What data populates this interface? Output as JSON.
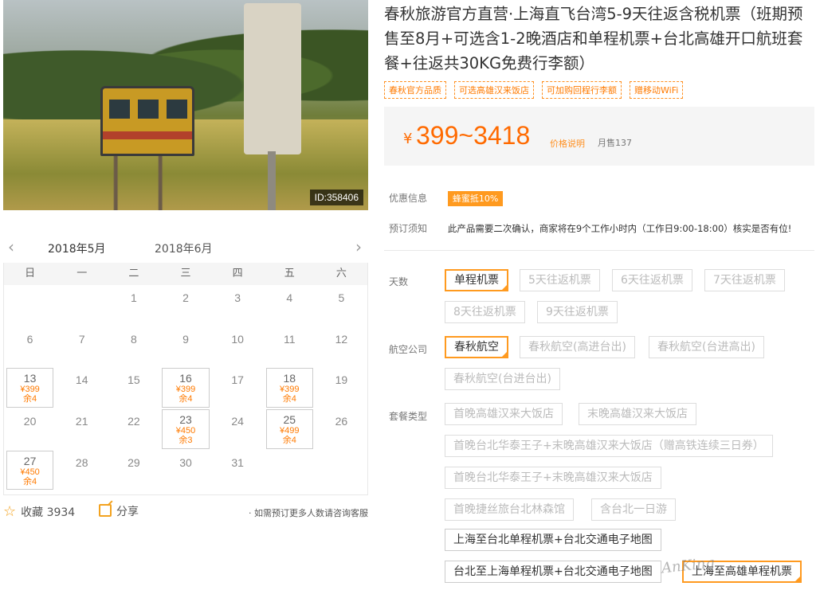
{
  "photo": {
    "id_label": "ID:358406"
  },
  "calendar": {
    "prev_icon": "chevron-left-icon",
    "next_icon": "chevron-right-icon",
    "months": [
      "2018年5月",
      "2018年6月"
    ],
    "weekdays": [
      "日",
      "一",
      "二",
      "三",
      "四",
      "五",
      "六"
    ],
    "days": [
      {
        "d": ""
      },
      {
        "d": ""
      },
      {
        "d": "1"
      },
      {
        "d": "2"
      },
      {
        "d": "3"
      },
      {
        "d": "4"
      },
      {
        "d": "5"
      },
      {
        "d": "6"
      },
      {
        "d": "7"
      },
      {
        "d": "8"
      },
      {
        "d": "9"
      },
      {
        "d": "10"
      },
      {
        "d": "11"
      },
      {
        "d": "12"
      },
      {
        "d": "13",
        "price": "¥399",
        "stock": "余4"
      },
      {
        "d": "14"
      },
      {
        "d": "15"
      },
      {
        "d": "16",
        "price": "¥399",
        "stock": "余4"
      },
      {
        "d": "17"
      },
      {
        "d": "18",
        "price": "¥399",
        "stock": "余4"
      },
      {
        "d": "19"
      },
      {
        "d": "20"
      },
      {
        "d": "21"
      },
      {
        "d": "22"
      },
      {
        "d": "23",
        "price": "¥450",
        "stock": "余3"
      },
      {
        "d": "24"
      },
      {
        "d": "25",
        "price": "¥499",
        "stock": "余4"
      },
      {
        "d": "26"
      },
      {
        "d": "27",
        "price": "¥450",
        "stock": "余4"
      },
      {
        "d": "28"
      },
      {
        "d": "29"
      },
      {
        "d": "30"
      },
      {
        "d": "31"
      },
      {
        "d": ""
      },
      {
        "d": ""
      }
    ]
  },
  "footer": {
    "favorite_label": "收藏 3934",
    "share_label": "分享",
    "group_note": "· 如需预订更多人数请咨询客服"
  },
  "product": {
    "title": "春秋旅游官方直营·上海直飞台湾5-9天往返含税机票（班期预售至8月+可选含1-2晚酒店和单程机票+台北高雄开口航班套餐+往返共30KG免费行李额）",
    "tags": [
      "春秋官方品质",
      "可选高雄汉来饭店",
      "可加购回程行李额",
      "赠移动WiFi"
    ],
    "currency": "¥",
    "price_range": "399~3418",
    "price_note": "价格说明",
    "monthly_sales": "月售137",
    "promo_label": "优惠信息",
    "promo_badge": "蜂蜜抵10%",
    "notice_label": "预订须知",
    "notice_text": "此产品需要二次确认，商家将在9个工作小时内（工作日9:00-18:00）核实是否有位!"
  },
  "options": {
    "days_label": "天数",
    "days": [
      "单程机票",
      "5天往返机票",
      "6天往返机票",
      "7天往返机票",
      "8天往返机票",
      "9天往返机票"
    ],
    "airline_label": "航空公司",
    "airlines": [
      "春秋航空",
      "春秋航空(高进台出)",
      "春秋航空(台进高出)",
      "春秋航空(台进台出)"
    ],
    "package_label": "套餐类型",
    "packages": [
      "首晚高雄汉来大饭店",
      "末晚高雄汉来大饭店",
      "首晚台北华泰王子+末晚高雄汉来大饭店（赠高铁连续三日券）",
      "首晚台北华泰王子+末晚高雄汉来大饭店",
      "首晚捷丝旅台北林森馆",
      "含台北一日游",
      "上海至台北单程机票+台北交通电子地图",
      "台北至上海单程机票+台北交通电子地图",
      "上海至高雄单程机票"
    ]
  },
  "watermark": "AnKing"
}
